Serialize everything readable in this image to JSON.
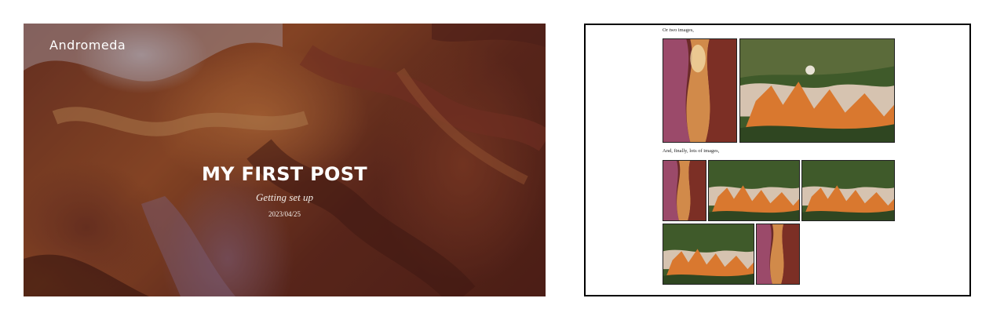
{
  "hero": {
    "brand": "Andromeda",
    "title": "MY FIRST POST",
    "subtitle": "Getting set up",
    "date": "2023/04/25"
  },
  "gallery": {
    "two_images_caption": "Or two images,",
    "many_images_caption": "And, finally, lots of images,"
  },
  "colors": {
    "canyon_dark": "#5a241c",
    "canyon_orange": "#c8763a",
    "hoodoo_orange": "#d9782f",
    "forest_green": "#3f5a2a"
  },
  "images": {
    "canyon": "antelope-canyon-photo",
    "hoodoos": "bryce-canyon-photo"
  }
}
